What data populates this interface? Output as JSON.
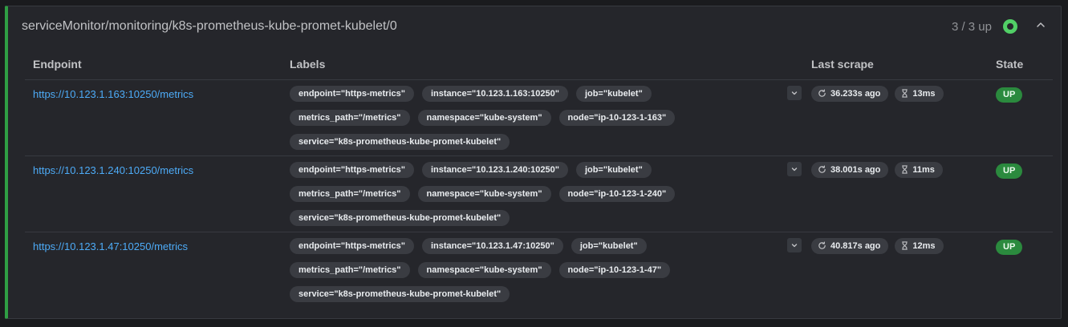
{
  "panel": {
    "title": "serviceMonitor/monitoring/k8s-prometheus-kube-promet-kubelet/0",
    "up_count": "3 / 3 up",
    "health_color": "#51cf66"
  },
  "columns": {
    "endpoint": "Endpoint",
    "labels": "Labels",
    "last_scrape": "Last scrape",
    "state": "State"
  },
  "rows": [
    {
      "endpoint": "https://10.123.1.163:10250/metrics",
      "labels": [
        "endpoint=\"https-metrics\"",
        "instance=\"10.123.1.163:10250\"",
        "job=\"kubelet\"",
        "metrics_path=\"/metrics\"",
        "namespace=\"kube-system\"",
        "node=\"ip-10-123-1-163\"",
        "service=\"k8s-prometheus-kube-promet-kubelet\""
      ],
      "last_scrape": "36.233s ago",
      "duration": "13ms",
      "state": "UP"
    },
    {
      "endpoint": "https://10.123.1.240:10250/metrics",
      "labels": [
        "endpoint=\"https-metrics\"",
        "instance=\"10.123.1.240:10250\"",
        "job=\"kubelet\"",
        "metrics_path=\"/metrics\"",
        "namespace=\"kube-system\"",
        "node=\"ip-10-123-1-240\"",
        "service=\"k8s-prometheus-kube-promet-kubelet\""
      ],
      "last_scrape": "38.001s ago",
      "duration": "11ms",
      "state": "UP"
    },
    {
      "endpoint": "https://10.123.1.47:10250/metrics",
      "labels": [
        "endpoint=\"https-metrics\"",
        "instance=\"10.123.1.47:10250\"",
        "job=\"kubelet\"",
        "metrics_path=\"/metrics\"",
        "namespace=\"kube-system\"",
        "node=\"ip-10-123-1-47\"",
        "service=\"k8s-prometheus-kube-promet-kubelet\""
      ],
      "last_scrape": "40.817s ago",
      "duration": "12ms",
      "state": "UP"
    }
  ],
  "icons": {
    "collapse": "chevron-up-icon",
    "expand": "chevron-down-icon",
    "scrape": "refresh-icon",
    "duration": "hourglass-icon",
    "health": "status-dot-icon"
  },
  "colors": {
    "accent_border": "#2f9e44",
    "link": "#4dabf7",
    "state_up": "#2b8a3e"
  }
}
